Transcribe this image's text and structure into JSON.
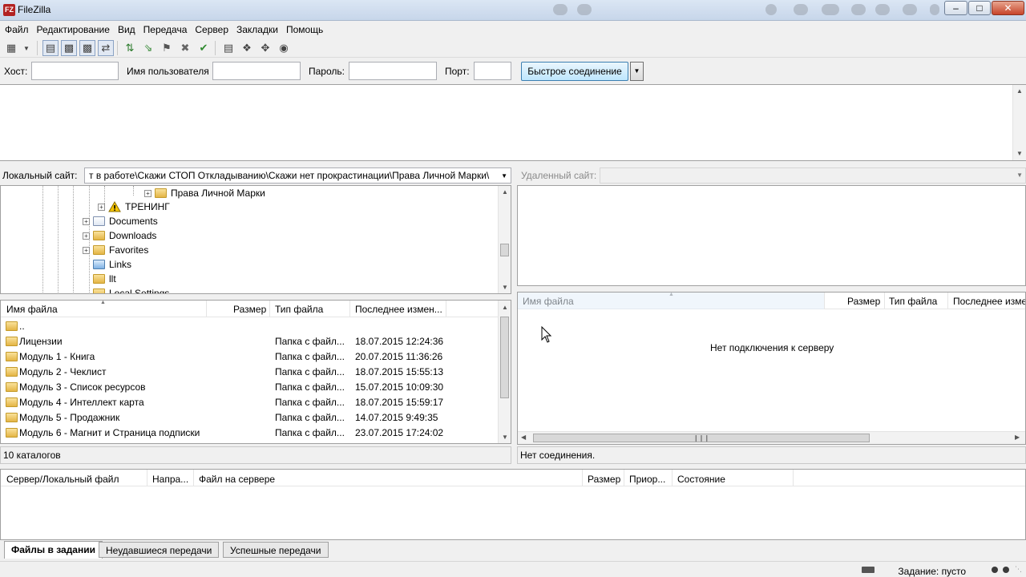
{
  "window": {
    "title": "FileZilla"
  },
  "menu": [
    "Файл",
    "Редактирование",
    "Вид",
    "Передача",
    "Сервер",
    "Закладки",
    "Помощь"
  ],
  "quickconnect": {
    "host_label": "Хост:",
    "user_label": "Имя пользователя",
    "pass_label": "Пароль:",
    "port_label": "Порт:",
    "host_value": "",
    "user_value": "",
    "pass_value": "",
    "port_value": "",
    "button_label": "Быстрое соединение"
  },
  "local": {
    "site_label": "Локальный сайт:",
    "path": "т в работе\\Скажи СТОП Откладыванию\\Скажи нет прокрастинации\\Права Личной Марки\\",
    "tree": [
      {
        "label": "Права Личной Марки",
        "icon": "folder-open-icon"
      },
      {
        "label": "ТРЕНИНГ",
        "icon": "warning-icon"
      },
      {
        "label": "Documents",
        "icon": "documents-folder-icon"
      },
      {
        "label": "Downloads",
        "icon": "downloads-folder-icon"
      },
      {
        "label": "Favorites",
        "icon": "favorites-folder-icon"
      },
      {
        "label": "Links",
        "icon": "links-folder-icon"
      },
      {
        "label": "llt",
        "icon": "folder-icon"
      },
      {
        "label": "Local Settings",
        "icon": "folder-icon"
      }
    ],
    "columns": {
      "name": "Имя файла",
      "size": "Размер",
      "type": "Тип файла",
      "modified": "Последнее измен..."
    },
    "files": [
      {
        "name": "..",
        "type": "",
        "modified": ""
      },
      {
        "name": "Лицензии",
        "type": "Папка с файл...",
        "modified": "18.07.2015 12:24:36"
      },
      {
        "name": "Модуль 1 - Книга",
        "type": "Папка с файл...",
        "modified": "20.07.2015 11:36:26"
      },
      {
        "name": "Модуль 2 - Чеклист",
        "type": "Папка с файл...",
        "modified": "18.07.2015 15:55:13"
      },
      {
        "name": "Модуль 3 - Список ресурсов",
        "type": "Папка с файл...",
        "modified": "15.07.2015 10:09:30"
      },
      {
        "name": "Модуль 4 - Интеллект карта",
        "type": "Папка с файл...",
        "modified": "18.07.2015 15:59:17"
      },
      {
        "name": "Модуль 5 - Продажник",
        "type": "Папка с файл...",
        "modified": "14.07.2015 9:49:35"
      },
      {
        "name": "Модуль 6 - Магнит и Страница подписки",
        "type": "Папка с файл...",
        "modified": "23.07.2015 17:24:02"
      }
    ],
    "status": "10 каталогов"
  },
  "remote": {
    "site_label": "Удаленный сайт:",
    "columns": {
      "name": "Имя файла",
      "size": "Размер",
      "type": "Тип файла",
      "modified": "Последнее изме"
    },
    "empty_message": "Нет подключения к серверу",
    "status": "Нет соединения."
  },
  "queue": {
    "columns": {
      "file": "Сервер/Локальный файл",
      "direction": "Напра...",
      "remote": "Файл на сервере",
      "size": "Размер",
      "priority": "Приор...",
      "state": "Состояние"
    },
    "tabs": [
      "Файлы в задании",
      "Неудавшиеся передачи",
      "Успешные передачи"
    ]
  },
  "statusbar": {
    "job": "Задание: пусто"
  }
}
